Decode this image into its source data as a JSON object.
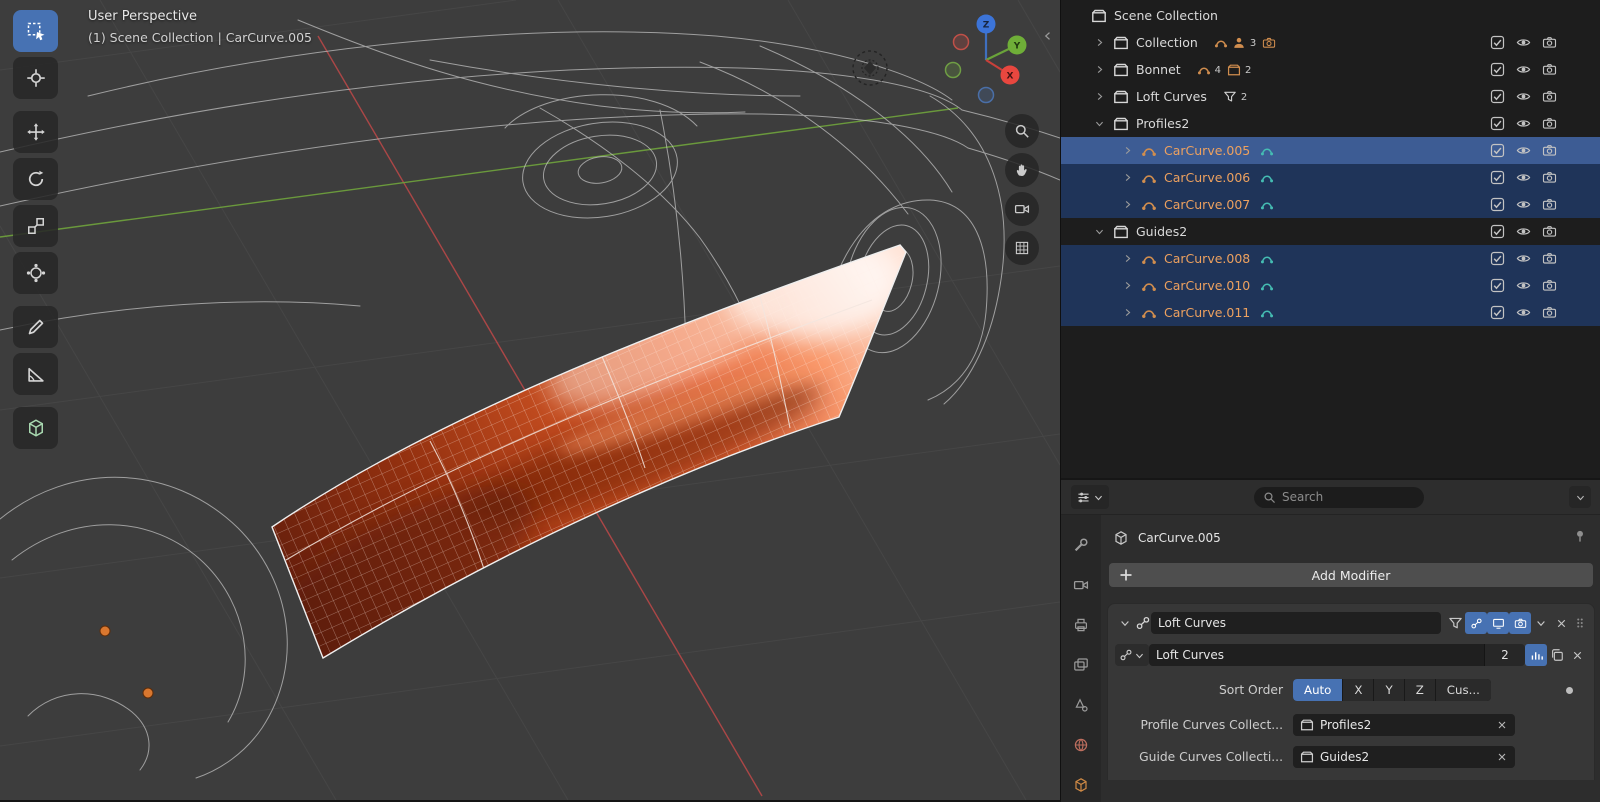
{
  "viewport": {
    "perspective_label": "User Perspective",
    "context_label": "(1) Scene Collection | CarCurve.005",
    "gizmo": {
      "x": "X",
      "y": "Y",
      "z": "Z"
    }
  },
  "toolbar": {
    "tools": [
      "select-box",
      "cursor",
      "move",
      "rotate",
      "scale",
      "transform",
      "annotate",
      "measure",
      "add-cube"
    ],
    "active_tool": "select-box"
  },
  "outliner": {
    "rows": [
      {
        "label": "Scene Collection",
        "icon": "collection"
      },
      {
        "label": "Collection",
        "icon": "collection",
        "counts": {
          "objects": "3"
        }
      },
      {
        "label": "Bonnet",
        "icon": "collection",
        "counts": {
          "curves": "4",
          "collections": "2"
        }
      },
      {
        "label": "Loft Curves",
        "icon": "collection",
        "counts": {
          "nodes": "2"
        }
      },
      {
        "label": "Profiles2",
        "icon": "collection",
        "expanded": true
      },
      {
        "label": "CarCurve.005",
        "icon": "curve",
        "state": "active"
      },
      {
        "label": "CarCurve.006",
        "icon": "curve",
        "state": "selected"
      },
      {
        "label": "CarCurve.007",
        "icon": "curve",
        "state": "selected"
      },
      {
        "label": "Guides2",
        "icon": "collection",
        "expanded": true
      },
      {
        "label": "CarCurve.008",
        "icon": "curve",
        "state": "selected"
      },
      {
        "label": "CarCurve.010",
        "icon": "curve",
        "state": "selected"
      },
      {
        "label": "CarCurve.011",
        "icon": "curve",
        "state": "selected"
      }
    ]
  },
  "properties": {
    "search_placeholder": "Search",
    "active_object": "CarCurve.005",
    "add_modifier_label": "Add Modifier",
    "modifier": {
      "name": "Loft Curves",
      "node_group": "Loft Curves",
      "users": "2",
      "sort_order_label": "Sort Order",
      "sort_options": [
        "Auto",
        "X",
        "Y",
        "Z",
        "Cus..."
      ],
      "sort_active": "Auto",
      "profile_label": "Profile Curves Collect...",
      "profile_value": "Profiles2",
      "guide_label": "Guide Curves Collecti...",
      "guide_value": "Guides2"
    }
  },
  "colors": {
    "accent_blue": "#4772b3",
    "active_row": "#3d5c94",
    "selected_row": "#1f3459",
    "orange_text": "#eda15f",
    "teal_icon": "#45bdb3",
    "axis_x": "#b84848",
    "axis_y": "#6d9e3c",
    "surface_dark": "#5e1c0c",
    "surface_bright": "#e8693a"
  }
}
